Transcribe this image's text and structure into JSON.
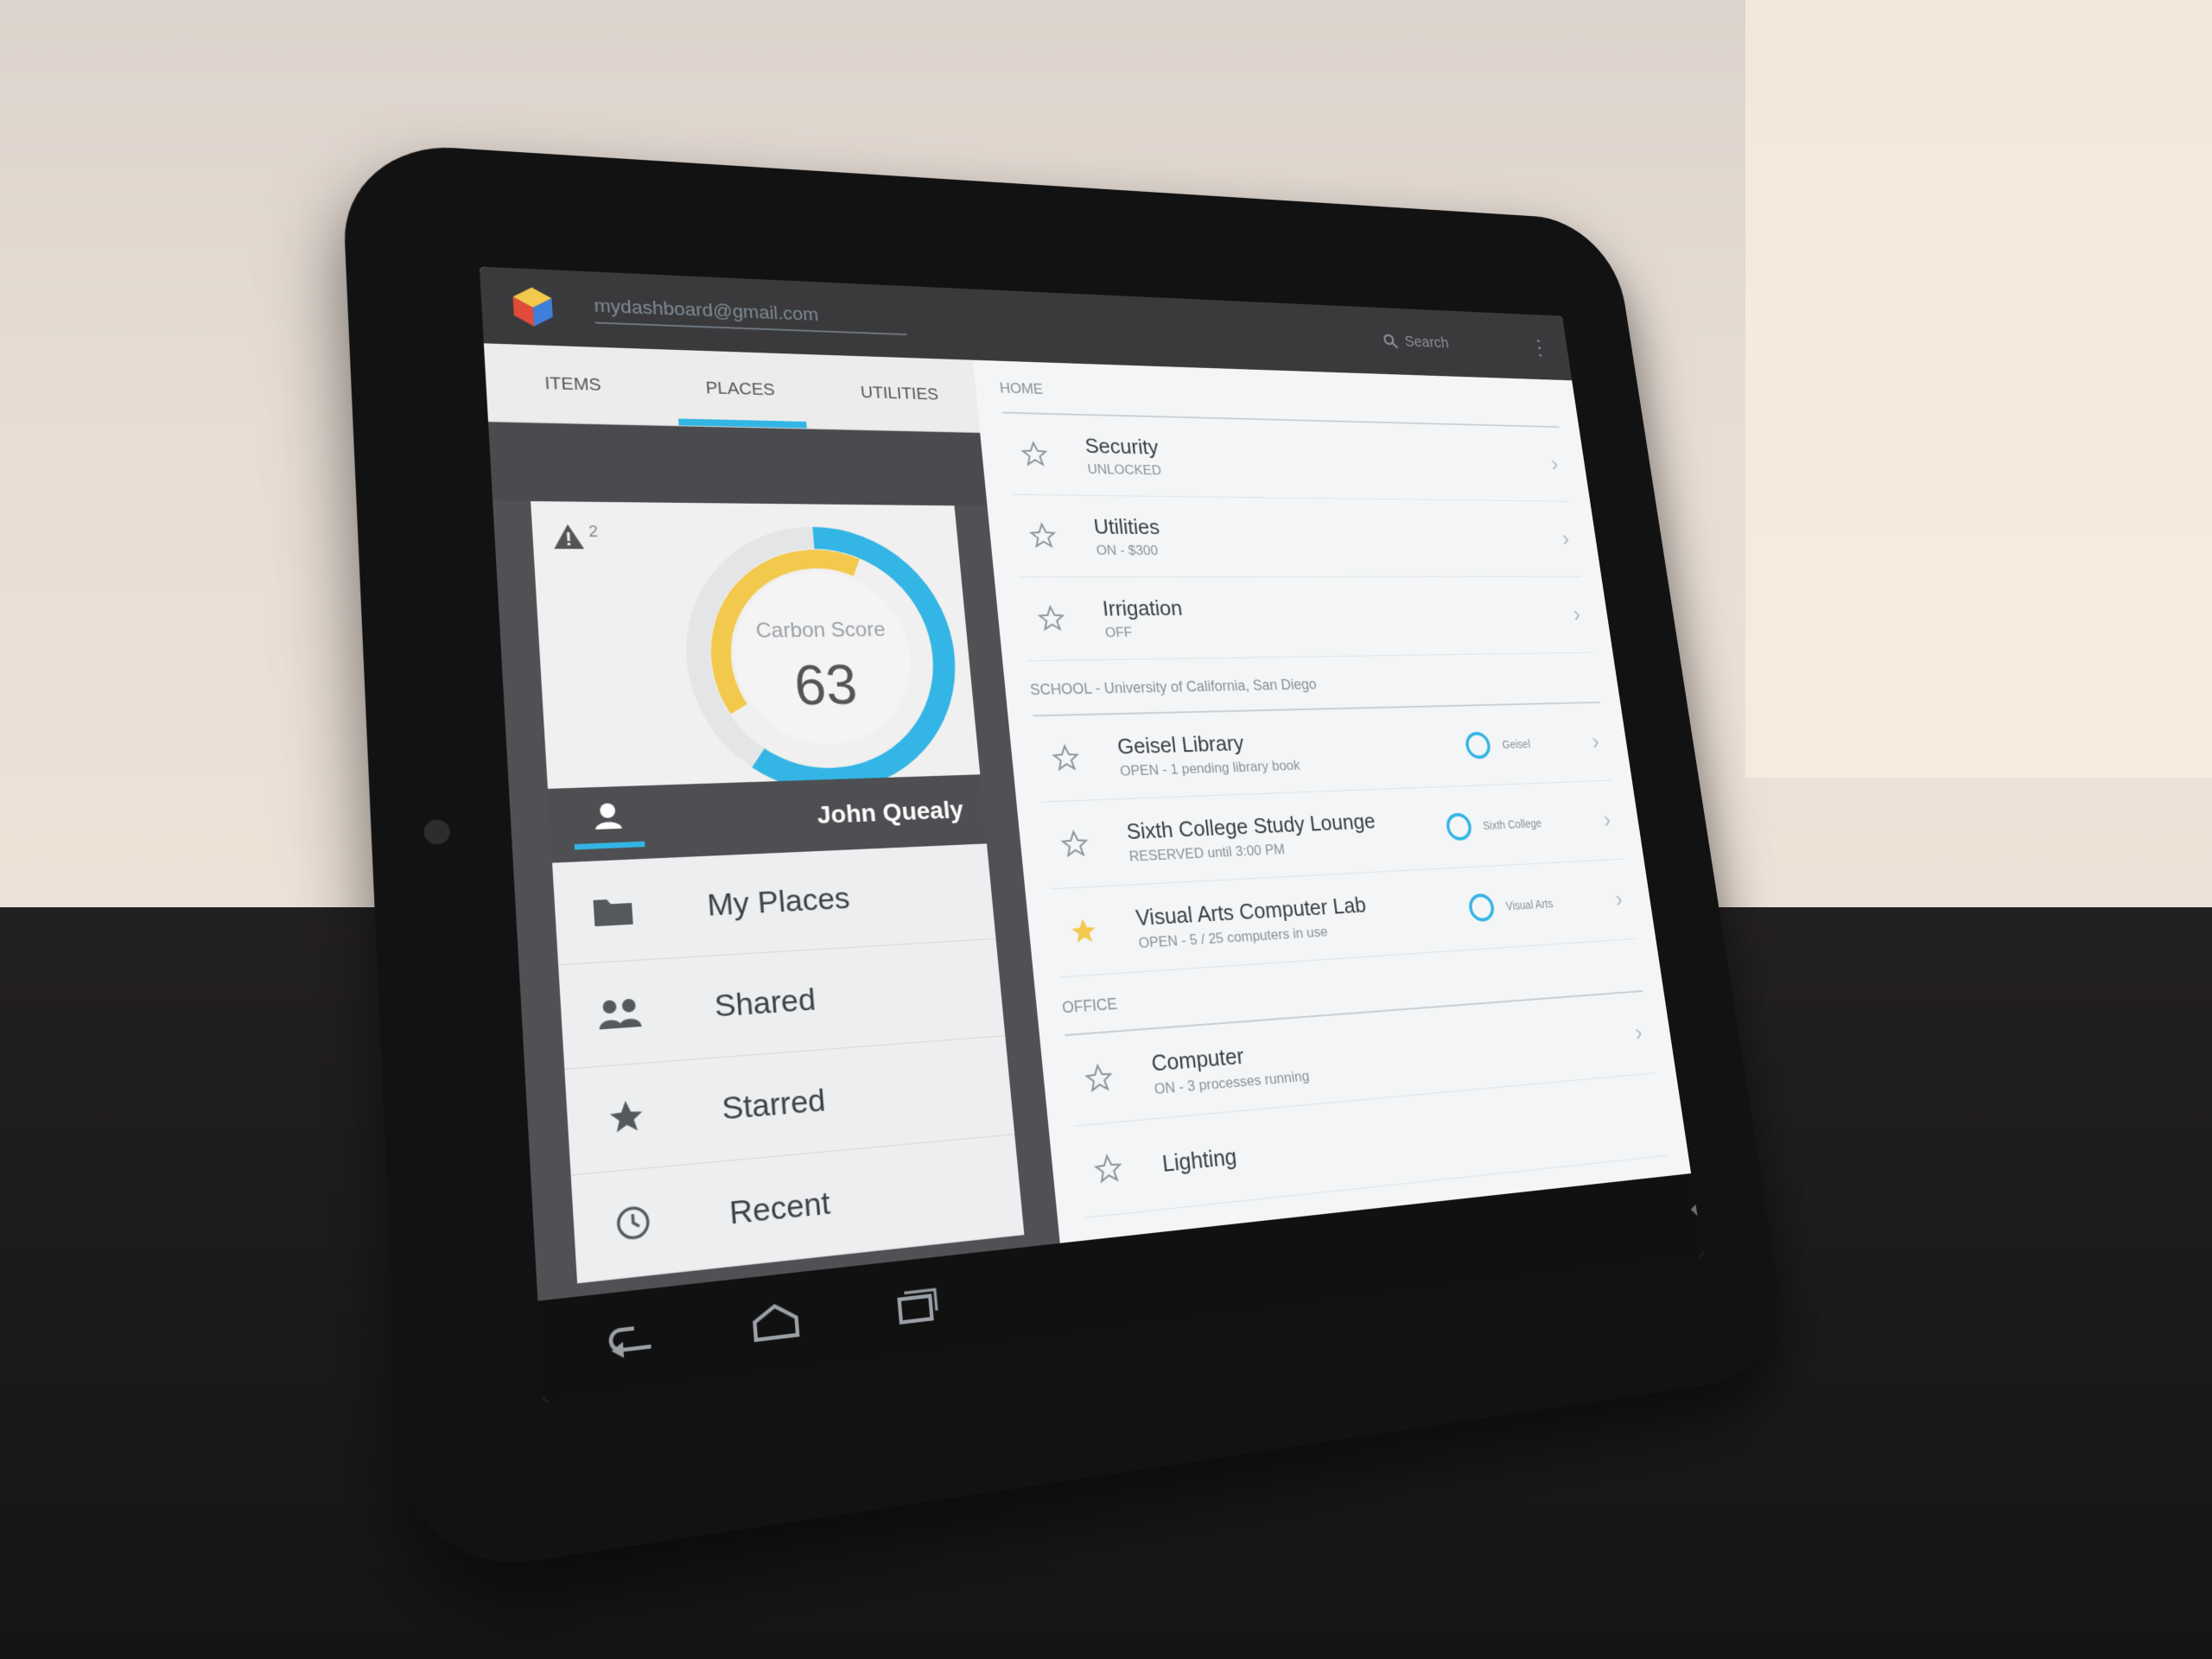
{
  "app": {
    "url": "mydashboard@gmail.com",
    "search_placeholder": "Search"
  },
  "tabs": [
    {
      "label": "ITEMS"
    },
    {
      "label": "PLACES"
    },
    {
      "label": "UTILITIES"
    }
  ],
  "dashboard": {
    "alert_count": "2",
    "carbon_label": "Carbon Score",
    "carbon_score": "63",
    "user_name": "John Quealy"
  },
  "menu": [
    {
      "label": "My Places",
      "icon": "folder-icon"
    },
    {
      "label": "Shared",
      "icon": "people-icon"
    },
    {
      "label": "Starred",
      "icon": "star-icon"
    },
    {
      "label": "Recent",
      "icon": "clock-icon"
    }
  ],
  "sections": {
    "home": {
      "header": "HOME",
      "items": [
        {
          "title": "Security",
          "subtitle": "UNLOCKED"
        },
        {
          "title": "Utilities",
          "subtitle": "ON - $300"
        },
        {
          "title": "Irrigation",
          "subtitle": "OFF"
        }
      ]
    },
    "school": {
      "header": "SCHOOL - University of California, San Diego",
      "items": [
        {
          "title": "Geisel Library",
          "subtitle": "OPEN - 1 pending library book",
          "mini": "Geisel"
        },
        {
          "title": "Sixth College Study Lounge",
          "subtitle": "RESERVED until 3:00 PM",
          "mini": "Sixth College"
        },
        {
          "title": "Visual Arts Computer Lab",
          "subtitle": "OPEN - 5 / 25 computers in use",
          "mini": "Visual Arts"
        }
      ]
    },
    "office": {
      "header": "OFFICE",
      "items": [
        {
          "title": "Computer",
          "subtitle": "ON - 3 processes running"
        },
        {
          "title": "Lighting",
          "subtitle": ""
        }
      ]
    }
  },
  "colors": {
    "accent": "#33b5e5",
    "gauge_yellow": "#f2c94c",
    "gauge_blue": "#33b5e5",
    "star_active": "#f2c94c"
  },
  "gauge": {
    "blue_fraction": 0.6,
    "yellow_fraction": 0.4
  }
}
